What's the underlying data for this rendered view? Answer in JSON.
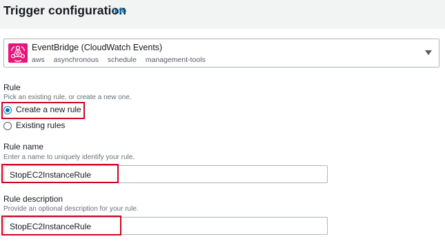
{
  "header": {
    "title": "Trigger configuration",
    "info_label": "Info"
  },
  "trigger": {
    "name": "EventBridge (CloudWatch Events)",
    "tags": [
      "aws",
      "asynchronous",
      "schedule",
      "management-tools"
    ],
    "icon": "eventbridge-icon",
    "icon_color": "#e7157b"
  },
  "rule": {
    "label": "Rule",
    "description": "Pick an existing rule, or create a new one.",
    "options": [
      {
        "label": "Create a new rule",
        "selected": true
      },
      {
        "label": "Existing rules",
        "selected": false
      }
    ]
  },
  "rule_name": {
    "label": "Rule name",
    "description": "Enter a name to uniquely identify your rule.",
    "value": "StopEC2InstanceRule"
  },
  "rule_description": {
    "label": "Rule description",
    "description": "Provide an optional description for your rule.",
    "value": "StopEC2InstanceRule"
  },
  "colors": {
    "accent": "#0073bb",
    "highlight": "#d0021b",
    "header_bg": "#f2f3f3"
  }
}
